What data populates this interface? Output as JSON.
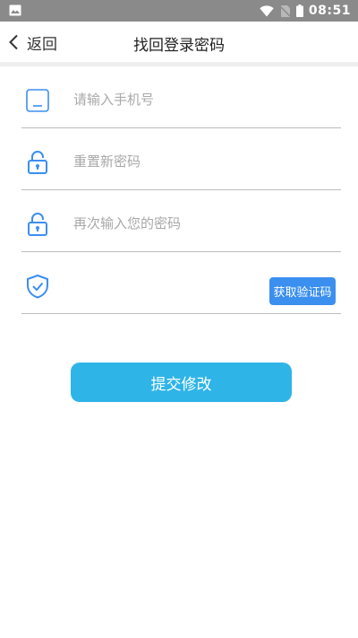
{
  "status_bar": {
    "time": "08:51",
    "icons": [
      "image-icon",
      "wifi-icon",
      "no-sim-icon",
      "battery-icon"
    ]
  },
  "app_bar": {
    "back_label": "返回",
    "title": "找回登录密码"
  },
  "form": {
    "phone": {
      "placeholder": "请输入手机号",
      "value": "",
      "icon": "phone-icon"
    },
    "new_password": {
      "placeholder": "重置新密码",
      "value": "",
      "icon": "lock-icon"
    },
    "confirm_password": {
      "placeholder": "再次输入您的密码",
      "value": "",
      "icon": "lock-icon"
    },
    "verification": {
      "placeholder": "",
      "value": "",
      "icon": "shield-check-icon",
      "button_label": "获取验证码"
    }
  },
  "submit_label": "提交修改",
  "colors": {
    "accent": "#3b8fef",
    "submit": "#2fb4e8",
    "icon": "#3b8fef",
    "status_bar": "#8a8a8a"
  }
}
